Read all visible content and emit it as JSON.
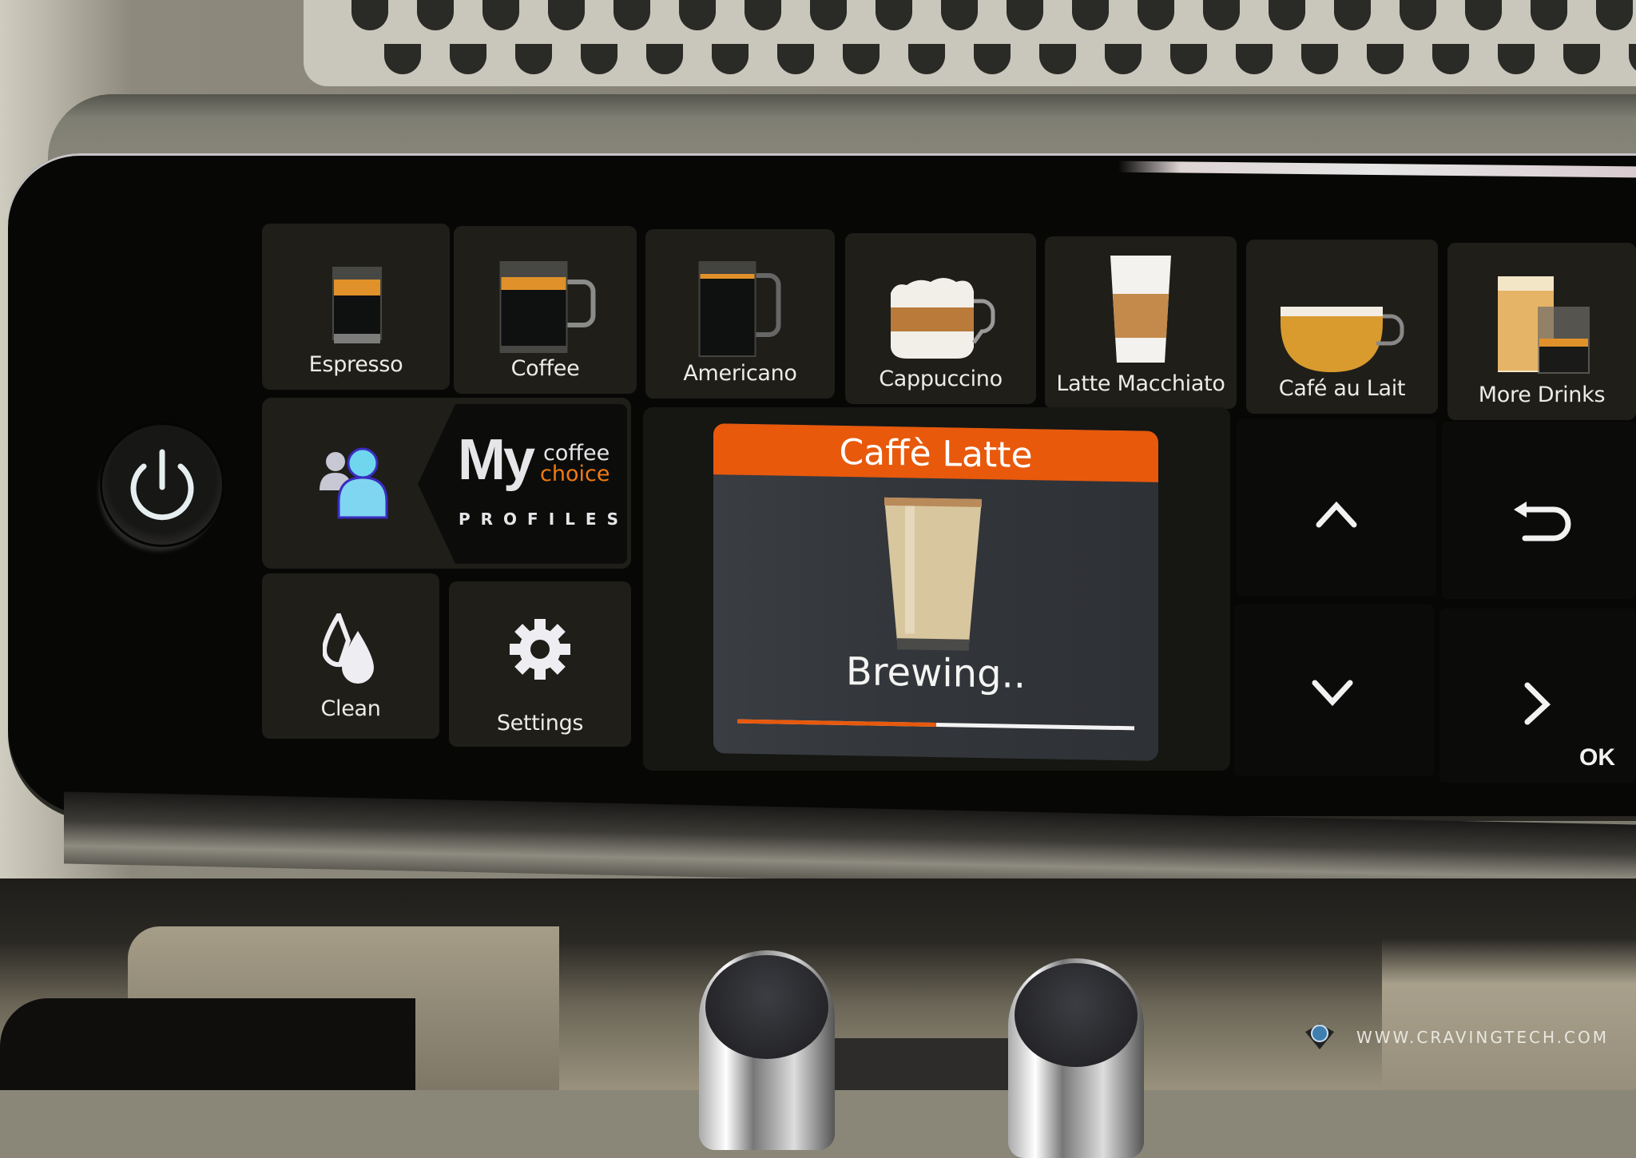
{
  "drinks": [
    {
      "name": "espresso",
      "label": "Espresso"
    },
    {
      "name": "coffee",
      "label": "Coffee"
    },
    {
      "name": "americano",
      "label": "Americano"
    },
    {
      "name": "cappuccino",
      "label": "Cappuccino"
    },
    {
      "name": "latte-macchiato",
      "label": "Latte Macchiato"
    },
    {
      "name": "cafe-au-lait",
      "label": "Café au Lait"
    },
    {
      "name": "more-drinks",
      "label": "More Drinks"
    }
  ],
  "profiles": {
    "my": "My",
    "coffee": "coffee",
    "choice": "choice",
    "profiles": "PROFILES",
    "icon": "profiles-people-icon"
  },
  "actions": {
    "clean": {
      "label": "Clean",
      "icon": "water-drops-icon"
    },
    "settings": {
      "label": "Settings",
      "icon": "gear-icon"
    }
  },
  "popup": {
    "title": "Caffè Latte",
    "status": "Brewing..",
    "progress": 0.5,
    "accent": "#e8590c"
  },
  "nav": {
    "up": "chevron-up-icon",
    "back": "back-arrow-icon",
    "down": "chevron-down-icon",
    "right": "chevron-right-icon",
    "ok_label": "OK"
  },
  "power": {
    "icon": "power-icon"
  },
  "watermark": "WWW.CRAVINGTECH.COM",
  "colors": {
    "accent": "#e8590c",
    "choice": "#f07a12",
    "profile_highlight": "#7fd6f0"
  }
}
